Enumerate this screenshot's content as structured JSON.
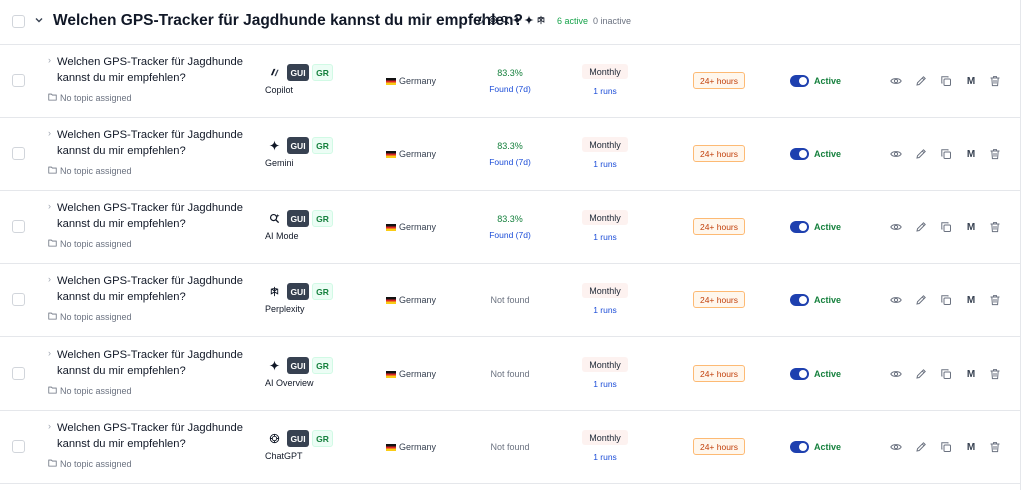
{
  "group": {
    "title": "Welchen GPS-Tracker für Jagdhunde kannst du mir empfehlen?",
    "mini_icons": [
      "copilot-icon",
      "chatgpt-icon",
      "ai-mode-icon",
      "gemini-sparkle-icon",
      "gemini-sparkle-icon",
      "perplexity-icon"
    ],
    "active_count": "6 active",
    "inactive_count": "0 inactive"
  },
  "rows": [
    {
      "prompt": "Welchen GPS-Tracker für Jagdhunde kannst du mir empfehlen?",
      "topic": "No topic assigned",
      "engine": "Copilot",
      "engine_icon": "copilot-icon",
      "gui": "GUI",
      "gr": "GR",
      "country": "Germany",
      "visibility": "83.3%",
      "found": "Found (7d)",
      "frequency": "Monthly",
      "runs": "1 runs",
      "latency": "24+ hours",
      "status": "Active",
      "m": "M"
    },
    {
      "prompt": "Welchen GPS-Tracker für Jagdhunde kannst du mir empfehlen?",
      "topic": "No topic assigned",
      "engine": "Gemini",
      "engine_icon": "gemini-sparkle-icon",
      "gui": "GUI",
      "gr": "GR",
      "country": "Germany",
      "visibility": "83.3%",
      "found": "Found (7d)",
      "frequency": "Monthly",
      "runs": "1 runs",
      "latency": "24+ hours",
      "status": "Active",
      "m": "M"
    },
    {
      "prompt": "Welchen GPS-Tracker für Jagdhunde kannst du mir empfehlen?",
      "topic": "No topic assigned",
      "engine": "AI Mode",
      "engine_icon": "ai-mode-icon",
      "gui": "GUI",
      "gr": "GR",
      "country": "Germany",
      "visibility": "83.3%",
      "found": "Found (7d)",
      "frequency": "Monthly",
      "runs": "1 runs",
      "latency": "24+ hours",
      "status": "Active",
      "m": "M"
    },
    {
      "prompt": "Welchen GPS-Tracker für Jagdhunde kannst du mir empfehlen?",
      "topic": "No topic assigned",
      "engine": "Perplexity",
      "engine_icon": "perplexity-icon",
      "gui": "GUI",
      "gr": "GR",
      "country": "Germany",
      "not_found": "Not found",
      "frequency": "Monthly",
      "runs": "1 runs",
      "latency": "24+ hours",
      "status": "Active",
      "m": "M"
    },
    {
      "prompt": "Welchen GPS-Tracker für Jagdhunde kannst du mir empfehlen?",
      "topic": "No topic assigned",
      "engine": "AI Overview",
      "engine_icon": "gemini-sparkle-icon",
      "gui": "GUI",
      "gr": "GR",
      "country": "Germany",
      "not_found": "Not found",
      "frequency": "Monthly",
      "runs": "1 runs",
      "latency": "24+ hours",
      "status": "Active",
      "m": "M"
    },
    {
      "prompt": "Welchen GPS-Tracker für Jagdhunde kannst du mir empfehlen?",
      "topic": "No topic assigned",
      "engine": "ChatGPT",
      "engine_icon": "chatgpt-icon",
      "gui": "GUI",
      "gr": "GR",
      "country": "Germany",
      "not_found": "Not found",
      "frequency": "Monthly",
      "runs": "1 runs",
      "latency": "24+ hours",
      "status": "Active",
      "m": "M"
    }
  ],
  "colors": {
    "accent": "#1e40af",
    "success": "#15803d",
    "link": "#1d4ed8",
    "warning": "#c2410c"
  }
}
